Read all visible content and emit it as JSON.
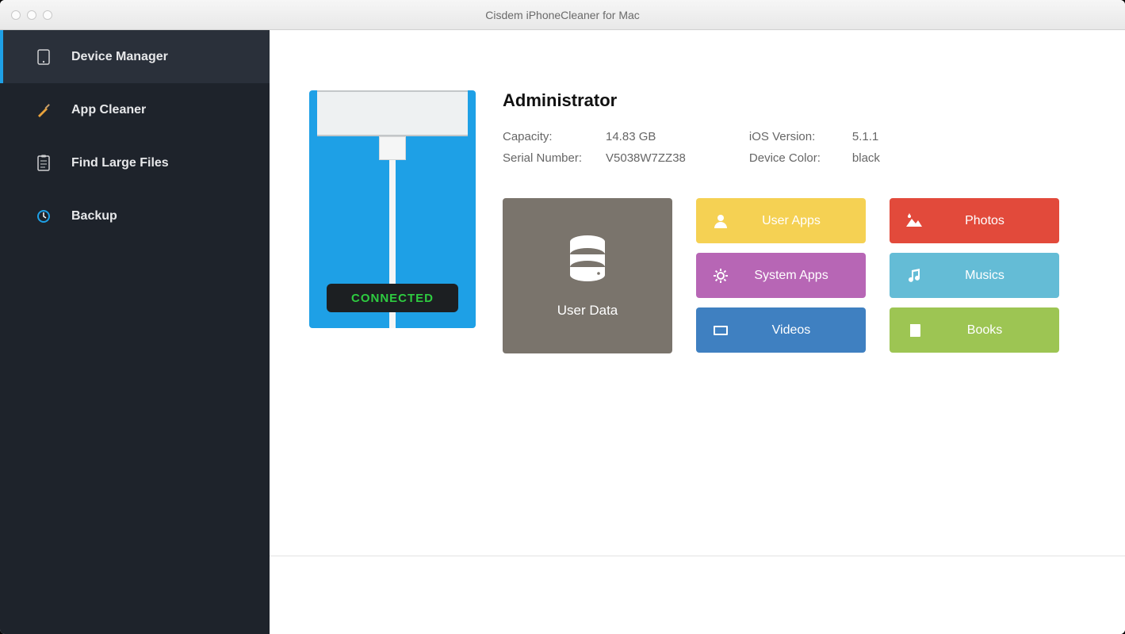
{
  "window": {
    "title": "Cisdem iPhoneCleaner for Mac"
  },
  "sidebar": {
    "items": [
      {
        "label": "Device Manager",
        "icon": "device-icon"
      },
      {
        "label": "App Cleaner",
        "icon": "broom-icon"
      },
      {
        "label": "Find Large Files",
        "icon": "clipboard-icon"
      },
      {
        "label": "Backup",
        "icon": "clock-icon"
      }
    ]
  },
  "device": {
    "name": "Administrator",
    "connection_status": "CONNECTED",
    "labels": {
      "capacity": "Capacity:",
      "serial": "Serial Number:",
      "ios": "iOS Version:",
      "color": "Device Color:"
    },
    "capacity": "14.83 GB",
    "serial": "V5038W7ZZ38",
    "ios_version": "5.1.1",
    "device_color": "black"
  },
  "tiles": {
    "big": {
      "label": "User Data"
    },
    "col1": [
      {
        "label": "User Apps"
      },
      {
        "label": "System Apps"
      },
      {
        "label": "Videos"
      }
    ],
    "col2": [
      {
        "label": "Photos"
      },
      {
        "label": "Musics"
      },
      {
        "label": "Books"
      }
    ]
  }
}
